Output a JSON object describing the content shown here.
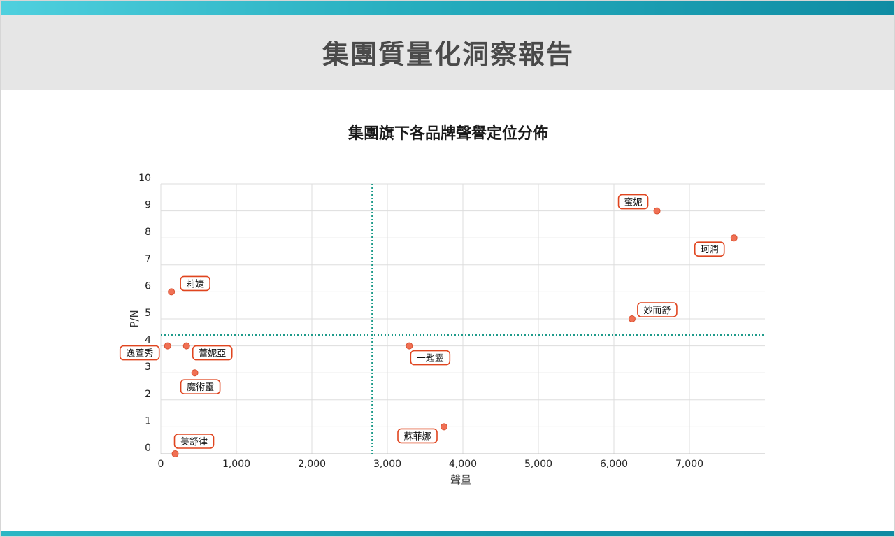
{
  "report": {
    "title": "集團質量化洞察報告"
  },
  "theme": {
    "accent": "#17a2b8",
    "point_color": "#f07054",
    "point_stroke": "#d8502f",
    "label_border": "#e0451f",
    "divider_color": "#1e9b8a",
    "grid_color": "#dddddd",
    "header_bg": "#e6e6e6"
  },
  "chart_data": {
    "type": "scatter",
    "title": "集團旗下各品牌聲譽定位分佈",
    "xlabel": "聲量",
    "ylabel": "P/N",
    "xlim": [
      0,
      8000
    ],
    "ylim": [
      0,
      10
    ],
    "x_ticks": [
      "0",
      "1,000",
      "2,000",
      "3,000",
      "4,000",
      "5,000",
      "6,000",
      "7,000"
    ],
    "y_ticks": [
      "0",
      "1",
      "2",
      "3",
      "4",
      "5",
      "6",
      "7",
      "8",
      "9",
      "10"
    ],
    "grid": true,
    "reference_lines": {
      "x": 2800,
      "y": 4.4
    },
    "points": [
      {
        "name": "蜜妮",
        "x": 6570,
        "y": 9.0
      },
      {
        "name": "珂潤",
        "x": 7590,
        "y": 8.0
      },
      {
        "name": "莉婕",
        "x": 140,
        "y": 6.0
      },
      {
        "name": "妙而舒",
        "x": 6240,
        "y": 5.0
      },
      {
        "name": "逸萱秀",
        "x": 90,
        "y": 4.0
      },
      {
        "name": "蕾妮亞",
        "x": 340,
        "y": 4.0
      },
      {
        "name": "一匙靈",
        "x": 3290,
        "y": 4.0
      },
      {
        "name": "魔術靈",
        "x": 450,
        "y": 3.0
      },
      {
        "name": "蘇菲娜",
        "x": 3750,
        "y": 1.0
      },
      {
        "name": "美舒律",
        "x": 190,
        "y": 0.0
      }
    ]
  }
}
